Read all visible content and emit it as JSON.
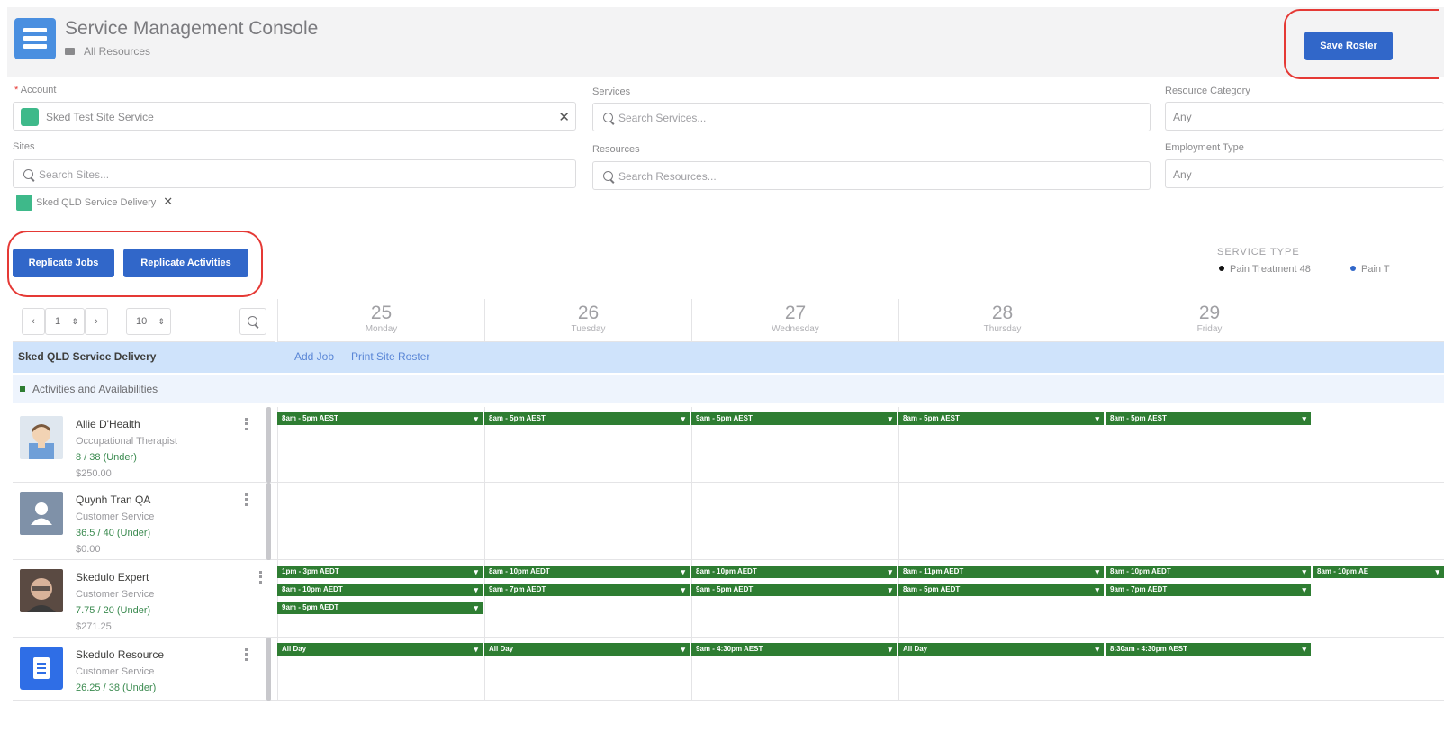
{
  "header": {
    "title": "Service Management Console",
    "subtitle": "All Resources",
    "save_roster_label": "Save Roster"
  },
  "filters": {
    "account": {
      "label": "Account",
      "value": "Sked Test Site Service"
    },
    "sites": {
      "label": "Sites",
      "placeholder": "Search Sites...",
      "selected_pill": "Sked QLD Service Delivery"
    },
    "services": {
      "label": "Services",
      "placeholder": "Search Services..."
    },
    "resources": {
      "label": "Resources",
      "placeholder": "Search Resources..."
    },
    "resource_category": {
      "label": "Resource Category",
      "value": "Any"
    },
    "employment_type": {
      "label": "Employment Type",
      "value": "Any"
    }
  },
  "actions": {
    "replicate_jobs": "Replicate Jobs",
    "replicate_activities": "Replicate Activities"
  },
  "legend": {
    "title": "SERVICE TYPE",
    "items": [
      {
        "label": "Pain Treatment 48",
        "color": "#111111"
      },
      {
        "label": "Pain T",
        "color": "#3167c9"
      }
    ]
  },
  "controls": {
    "page_value": "1",
    "weeks_value": "10"
  },
  "days": [
    {
      "num": "25",
      "name": "Monday"
    },
    {
      "num": "26",
      "name": "Tuesday"
    },
    {
      "num": "27",
      "name": "Wednesday"
    },
    {
      "num": "28",
      "name": "Thursday"
    },
    {
      "num": "29",
      "name": "Friday"
    }
  ],
  "site_row": {
    "name": "Sked QLD Service Delivery",
    "add_job": "Add Job",
    "print_site_roster": "Print Site Roster"
  },
  "activities_label": "Activities and Availabilities",
  "resources": [
    {
      "name": "Allie D'Health",
      "role": "Occupational Therapist",
      "hours": "8 / 38 (Under)",
      "amount": "$250.00",
      "events": [
        [
          "8am - 5pm AEST",
          "8am - 5pm AEST",
          "9am - 5pm AEST",
          "8am - 5pm AEST",
          "8am - 5pm AEST"
        ]
      ]
    },
    {
      "name": "Quynh Tran QA",
      "role": "Customer Service",
      "hours": "36.5 / 40 (Under)",
      "amount": "$0.00",
      "events": []
    },
    {
      "name": "Skedulo Expert",
      "role": "Customer Service",
      "hours": "7.75 / 20 (Under)",
      "amount": "$271.25",
      "events": [
        [
          "1pm - 3pm AEDT",
          "8am - 10pm AEDT",
          "8am - 10pm AEDT",
          "8am - 11pm AEDT",
          "8am - 10pm AEDT",
          "8am - 10pm AE"
        ],
        [
          "8am - 10pm AEDT",
          "9am - 7pm AEDT",
          "9am - 5pm AEDT",
          "8am - 5pm AEDT",
          "9am - 7pm AEDT"
        ],
        [
          "9am - 5pm AEDT"
        ]
      ]
    },
    {
      "name": "Skedulo Resource",
      "role": "Customer Service",
      "hours": "26.25 / 38 (Under)",
      "amount": "",
      "events": [
        [
          "All Day",
          "All Day",
          "9am - 4:30pm AEST",
          "All Day",
          "8:30am - 4:30pm AEST"
        ]
      ]
    }
  ]
}
